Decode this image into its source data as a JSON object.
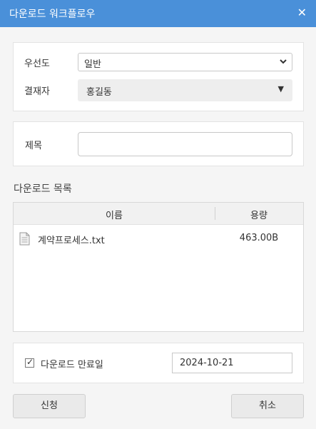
{
  "titlebar": {
    "title": "다운로드 워크플로우",
    "close_icon": "✕"
  },
  "form": {
    "priority_label": "우선도",
    "priority_value": "일반",
    "approver_label": "결재자",
    "approver_value": "홍길동",
    "subject_label": "제목",
    "subject_value": ""
  },
  "download_list": {
    "section_title": "다운로드 목록",
    "columns": [
      "이름",
      "용량"
    ],
    "rows": [
      {
        "name": "계약프로세스.txt",
        "size": "463.00B"
      }
    ]
  },
  "expiry": {
    "label": "다운로드 만료일",
    "checked": true,
    "date": "2024-10-21"
  },
  "buttons": {
    "apply": "신청",
    "cancel": "취소"
  }
}
